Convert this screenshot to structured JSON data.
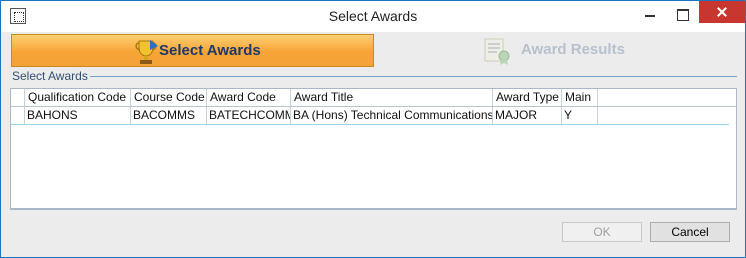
{
  "window": {
    "title": "Select Awards"
  },
  "steps": [
    {
      "label": "Select Awards",
      "icon": "trophy-icon",
      "active": true
    },
    {
      "label": "Award Results",
      "icon": "award-results-icon",
      "active": false
    }
  ],
  "group": {
    "label": "Select Awards"
  },
  "grid": {
    "columns": [
      "Qualification Code",
      "Course Code",
      "Award Code",
      "Award Title",
      "Award Type",
      "Main"
    ],
    "rows": [
      [
        "BAHONS",
        "BACOMMS",
        "BATECHCOMM",
        "BA (Hons) Technical Communications",
        "MAJOR",
        "Y"
      ]
    ]
  },
  "buttons": {
    "ok": "OK",
    "cancel": "Cancel"
  },
  "colors": {
    "active_step": "#f7a435",
    "active_step_text": "#1d3a6e",
    "inactive_step_text": "#b7c1cd",
    "close_button": "#c7372f",
    "window_border": "#1e73be"
  }
}
